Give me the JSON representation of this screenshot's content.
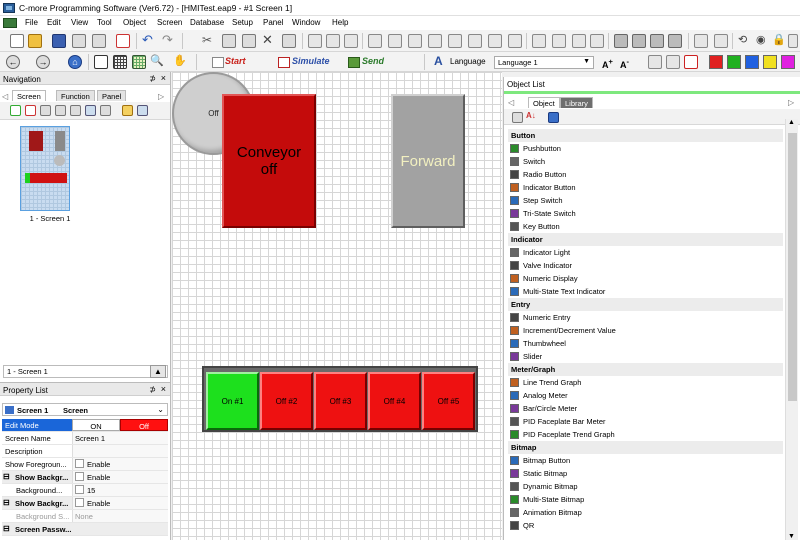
{
  "window": {
    "title": "C-more Programming Software (Ver6.72) - [HMITest.eap9 - #1 Screen 1]"
  },
  "menu": [
    "File",
    "Edit",
    "View",
    "Tool",
    "Object",
    "Screen",
    "Database",
    "Setup",
    "Panel",
    "Window",
    "Help"
  ],
  "toolbar2": {
    "start_label": "Start",
    "simulate_label": "Simulate",
    "send_label": "Send",
    "language_label": "Language",
    "language_value": "Language 1"
  },
  "navigation": {
    "title": "Navigation",
    "tabs": [
      "Screen",
      "Function",
      "Panel"
    ],
    "thumb_label": "1 - Screen 1",
    "selected_screen": "1 - Screen 1"
  },
  "property_list": {
    "title": "Property List",
    "object_name": "Screen 1",
    "object_type": "Screen",
    "rows": [
      {
        "name": "Edit Mode",
        "on": "ON",
        "off": "Off"
      },
      {
        "name": "Screen Name",
        "value": "Screen 1"
      },
      {
        "name": "Description",
        "value": ""
      },
      {
        "name": "Show Foregroun...",
        "value": "Enable"
      },
      {
        "name": "Show Backgr...",
        "value": "Enable"
      },
      {
        "name": "Background...",
        "value": "15"
      },
      {
        "name": "Show Backgr...",
        "value": "Enable"
      },
      {
        "name": "Background S...",
        "value": "None"
      },
      {
        "name": "Screen Passw...",
        "value": ""
      }
    ]
  },
  "canvas": {
    "conveyor_label": "Conveyor off",
    "forward_label": "Forward",
    "lamp_label": "Off",
    "segments": [
      {
        "label": "On #1",
        "state": "on"
      },
      {
        "label": "Off #2",
        "state": "off"
      },
      {
        "label": "Off #3",
        "state": "off"
      },
      {
        "label": "Off #4",
        "state": "off"
      },
      {
        "label": "Off #5",
        "state": "off"
      }
    ]
  },
  "object_list": {
    "title": "Object List",
    "tabs": [
      "Object",
      "Library"
    ],
    "groups": [
      {
        "name": "Button",
        "items": [
          "Pushbutton",
          "Switch",
          "Radio Button",
          "Indicator Button",
          "Step Switch",
          "Tri-State Switch",
          "Key Button"
        ]
      },
      {
        "name": "Indicator",
        "items": [
          "Indicator Light",
          "Valve Indicator",
          "Numeric Display",
          "Multi-State Text Indicator"
        ]
      },
      {
        "name": "Entry",
        "items": [
          "Numeric Entry",
          "Increment/Decrement Value",
          "Thumbwheel",
          "Slider"
        ]
      },
      {
        "name": "Meter/Graph",
        "items": [
          "Line Trend Graph",
          "Analog Meter",
          "Bar/Circle Meter",
          "PID Faceplate Bar Meter",
          "PID Faceplate Trend Graph"
        ]
      },
      {
        "name": "Bitmap",
        "items": [
          "Bitmap Button",
          "Static Bitmap",
          "Dynamic Bitmap",
          "Multi-State Bitmap",
          "Animation Bitmap",
          "QR"
        ]
      }
    ]
  },
  "colors": {
    "conveyor_red": "#c40b0b",
    "forward_gray": "#a2a2a2",
    "on_green": "#1de01d",
    "off_red": "#ee1111",
    "accent_green": "#7ee87e"
  },
  "palette": [
    "#e02020",
    "#20b020",
    "#2060e0",
    "#f0e020",
    "#e020e0"
  ]
}
